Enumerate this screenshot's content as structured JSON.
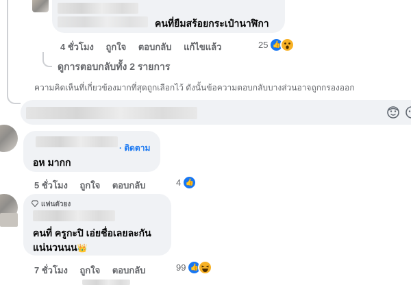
{
  "comment1": {
    "text": "คนที่ยืมสร้อยกระเป๋านาฬิกา",
    "time": "4 ชั่วโมง",
    "like_label": "ถูกใจ",
    "reply_label": "ตอบกลับ",
    "edited_label": "แก้ไขแล้ว",
    "reaction_count": "25",
    "reactions": [
      "like-icon",
      "wow-icon"
    ]
  },
  "view_replies": "ดูการตอบกลับทั้ง 2 รายการ",
  "filter_notice": "ความคิดเห็นที่เกี่ยวข้องมากที่สุดถูกเลือกไว้ ดังนั้นข้อความตอบกลับบางส่วนอาจถูกกรองออก",
  "composer": {
    "icons": [
      "sticker-icon",
      "emoji-icon"
    ]
  },
  "comment2": {
    "follow_label": "ติดตาม",
    "text": "อห มากก",
    "time": "5 ชั่วโมง",
    "like_label": "ถูกใจ",
    "reply_label": "ตอบกลับ",
    "reaction_count": "4",
    "reactions": [
      "like-icon"
    ]
  },
  "comment3": {
    "badge": "แฟนตัวยง",
    "line1": "คนที่ ครูกะปิ เอ่ยชื่อเลยละกัน",
    "line2": "แน่นวนนน",
    "emoji": "👑",
    "time": "7 ชั่วโมง",
    "like_label": "ถูกใจ",
    "reply_label": "ตอบกลับ",
    "reaction_count": "99",
    "reactions": [
      "like-icon",
      "haha-icon"
    ]
  },
  "colors": {
    "bubble": "#f0f2f5",
    "meta_text": "#65676b",
    "follow": "#1877f2",
    "like": "#1877f2",
    "wow": "#f7b125"
  }
}
